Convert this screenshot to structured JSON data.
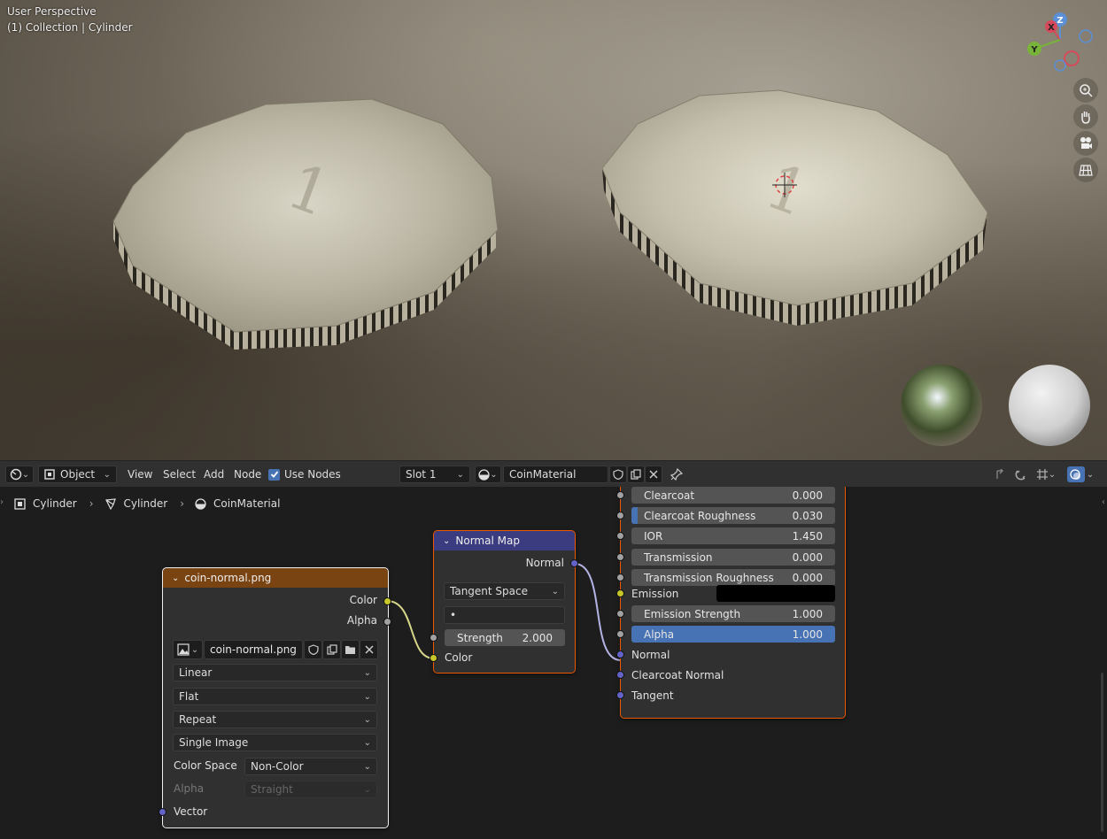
{
  "viewport": {
    "perspective_label": "User Perspective",
    "collection_label": "(1) Collection | Cylinder",
    "gizmo": {
      "x": "X",
      "y": "Y",
      "z": "Z"
    },
    "nav_icons": [
      "zoom-icon",
      "hand-icon",
      "camera-icon",
      "grid-icon"
    ]
  },
  "header": {
    "editor_type_icon": "node-editor-icon",
    "mode": "Object",
    "menus": [
      "View",
      "Select",
      "Add",
      "Node"
    ],
    "use_nodes_label": "Use Nodes",
    "use_nodes_checked": true,
    "slot": "Slot 1",
    "material_name": "CoinMaterial"
  },
  "breadcrumb": {
    "items": [
      "Cylinder",
      "Cylinder",
      "CoinMaterial"
    ]
  },
  "image_node": {
    "title": "coin-normal.png",
    "header_color": "#7a4412",
    "outputs": [
      "Color",
      "Alpha"
    ],
    "image_name": "coin-normal.png",
    "interpolation": "Linear",
    "projection": "Flat",
    "extension": "Repeat",
    "source": "Single Image",
    "color_space_label": "Color Space",
    "color_space": "Non-Color",
    "alpha_label": "Alpha",
    "alpha_mode": "Straight",
    "input": "Vector"
  },
  "normal_map_node": {
    "title": "Normal Map",
    "header_color": "#3b3b80",
    "output": "Normal",
    "space": "Tangent Space",
    "uv_map_placeholder": "•",
    "strength_label": "Strength",
    "strength_value": "2.000",
    "input": "Color"
  },
  "bsdf_node": {
    "fields": [
      {
        "label": "Clearcoat",
        "value": "0.000",
        "fill": 0
      },
      {
        "label": "Clearcoat Roughness",
        "value": "0.030",
        "fill": 0.03
      },
      {
        "label": "IOR",
        "value": "1.450",
        "fill": 0
      },
      {
        "label": "Transmission",
        "value": "0.000",
        "fill": 0
      },
      {
        "label": "Transmission Roughness",
        "value": "0.000",
        "fill": 0
      }
    ],
    "emission_label": "Emission",
    "emission_color": "#000000",
    "emission_strength_label": "Emission Strength",
    "emission_strength_value": "1.000",
    "alpha_label": "Alpha",
    "alpha_value": "1.000",
    "alpha_fill": 1,
    "vector_inputs": [
      "Normal",
      "Clearcoat Normal",
      "Tangent"
    ]
  },
  "colors": {
    "accent": "#4772b3",
    "selection": "#ed5700",
    "socket_color": "#c7c729",
    "socket_vector": "#6363c7",
    "socket_float": "#a1a1a1"
  }
}
